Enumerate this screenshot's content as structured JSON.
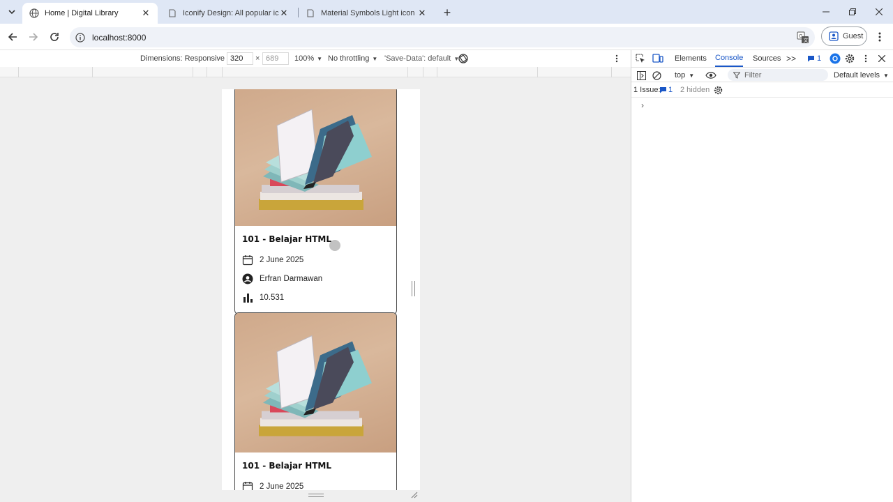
{
  "browser": {
    "tabs": [
      {
        "title": "Home | Digital Library",
        "active": true
      },
      {
        "title": "Iconify Design: All popular icon",
        "active": false
      },
      {
        "title": "Material Symbols Light icon set",
        "active": false
      }
    ],
    "new_tab": "+",
    "address": "localhost:8000",
    "profile_label": "Guest"
  },
  "device_toolbar": {
    "dimensions_label": "Dimensions: Responsive",
    "width_value": "320",
    "times": "×",
    "height_value": "689",
    "zoom": "100%",
    "throttling": "No throttling",
    "save_data": "'Save-Data': default"
  },
  "page": {
    "cards": [
      {
        "title": "101 - Belajar HTML",
        "date": "2 June 2025",
        "author": "Erfran Darmawan",
        "views": "10.531"
      },
      {
        "title": "101 - Belajar HTML",
        "date": "2 June 2025"
      }
    ]
  },
  "devtools": {
    "tabs": [
      "Elements",
      "Console",
      "Sources"
    ],
    "active_tab": "Console",
    "more": ">>",
    "issues_badge": "1",
    "context": "top",
    "filter_placeholder": "Filter",
    "levels": "Default levels",
    "issue_label": "1 Issue:",
    "issue_count": "1",
    "hidden_label": "2 hidden",
    "prompt": "›"
  },
  "colors": {
    "tabstrip_bg": "#dfe7f5",
    "devtools_accent": "#1a57c7",
    "page_bg": "#efefef"
  }
}
